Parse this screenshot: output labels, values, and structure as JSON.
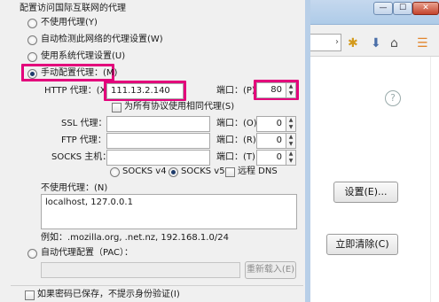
{
  "dialog": {
    "section_title": "配置访问国际互联网的代理",
    "options": {
      "no_proxy": "不使用代理(Y)",
      "auto_detect": "自动检测此网络的代理设置(W)",
      "use_system": "使用系统代理设置(U)",
      "manual": "手动配置代理：(M)"
    },
    "http": {
      "label": "HTTP 代理：(X)",
      "value": "111.13.2.140",
      "port_label": "端口：(P)",
      "port": "80"
    },
    "share_checkbox": "为所有协议使用相同代理(S)",
    "ssl": {
      "label": "SSL 代理：",
      "port_label": "端口：(O)",
      "port": "0"
    },
    "ftp": {
      "label": "FTP 代理：",
      "port_label": "端口：(R)",
      "port": "0"
    },
    "socks": {
      "label": "SOCKS 主机：",
      "port_label": "端口：(T)",
      "port": "0"
    },
    "socks_versions": {
      "v4": "SOCKS v4",
      "v5": "SOCKS v5",
      "remote_dns": "远程 DNS"
    },
    "no_proxy_for": {
      "label": "不使用代理：(N)",
      "value": "localhost, 127.0.0.1"
    },
    "example": "例如：.mozilla.org, .net.nz, 192.168.1.0/24",
    "auto_config": {
      "label": "自动代理配置（PAC）：",
      "reload": "重新载入(E)"
    },
    "no_prompt_checkbox": "如果密码已保存，不提示身份验证(I)"
  },
  "background": {
    "settings_button": "设置(E)...",
    "clear_now_button": "立即清除(C)",
    "window_buttons": {
      "minimize": "—",
      "maximize": "☐",
      "close": "✕"
    }
  },
  "colors": {
    "highlight": "#e3007b",
    "titlebar": "#aecbe8"
  }
}
